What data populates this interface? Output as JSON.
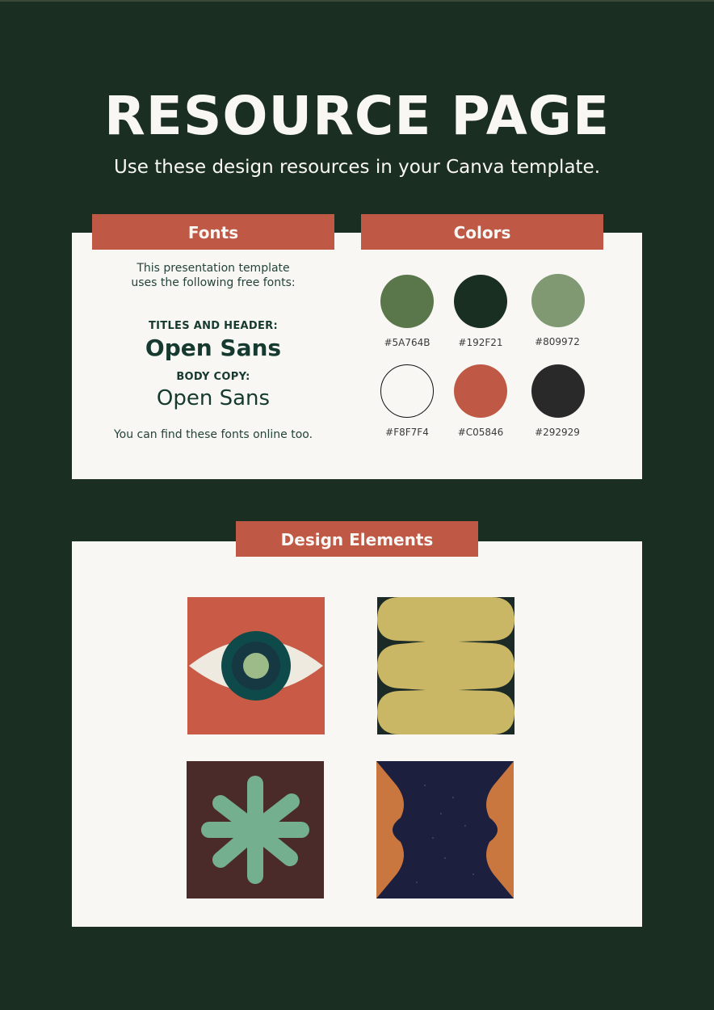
{
  "header": {
    "title": "RESOURCE PAGE",
    "subtitle": "Use these design resources in your Canva template."
  },
  "fonts": {
    "tab_label": "Fonts",
    "intro_line1": "This presentation template",
    "intro_line2": "uses the following free fonts:",
    "titles_label": "TITLES AND HEADER:",
    "titles_font": "Open Sans",
    "body_label": "BODY COPY:",
    "body_font": "Open Sans",
    "footer": "You can find these fonts online too."
  },
  "colors": {
    "tab_label": "Colors",
    "swatches": [
      {
        "hex": "#5A764B",
        "label": "#5A764B"
      },
      {
        "hex": "#192F21",
        "label": "#192F21"
      },
      {
        "hex": "#809972",
        "label": "#809972"
      },
      {
        "hex": "#F8F7F4",
        "label": "#F8F7F4"
      },
      {
        "hex": "#C05846",
        "label": "#C05846"
      },
      {
        "hex": "#292929",
        "label": "#292929"
      }
    ]
  },
  "design_elements": {
    "tab_label": "Design Elements",
    "items": [
      {
        "name": "eye-graphic"
      },
      {
        "name": "wavy-blob-graphic"
      },
      {
        "name": "asterisk-flower-graphic"
      },
      {
        "name": "wavy-night-sky-graphic"
      }
    ]
  }
}
